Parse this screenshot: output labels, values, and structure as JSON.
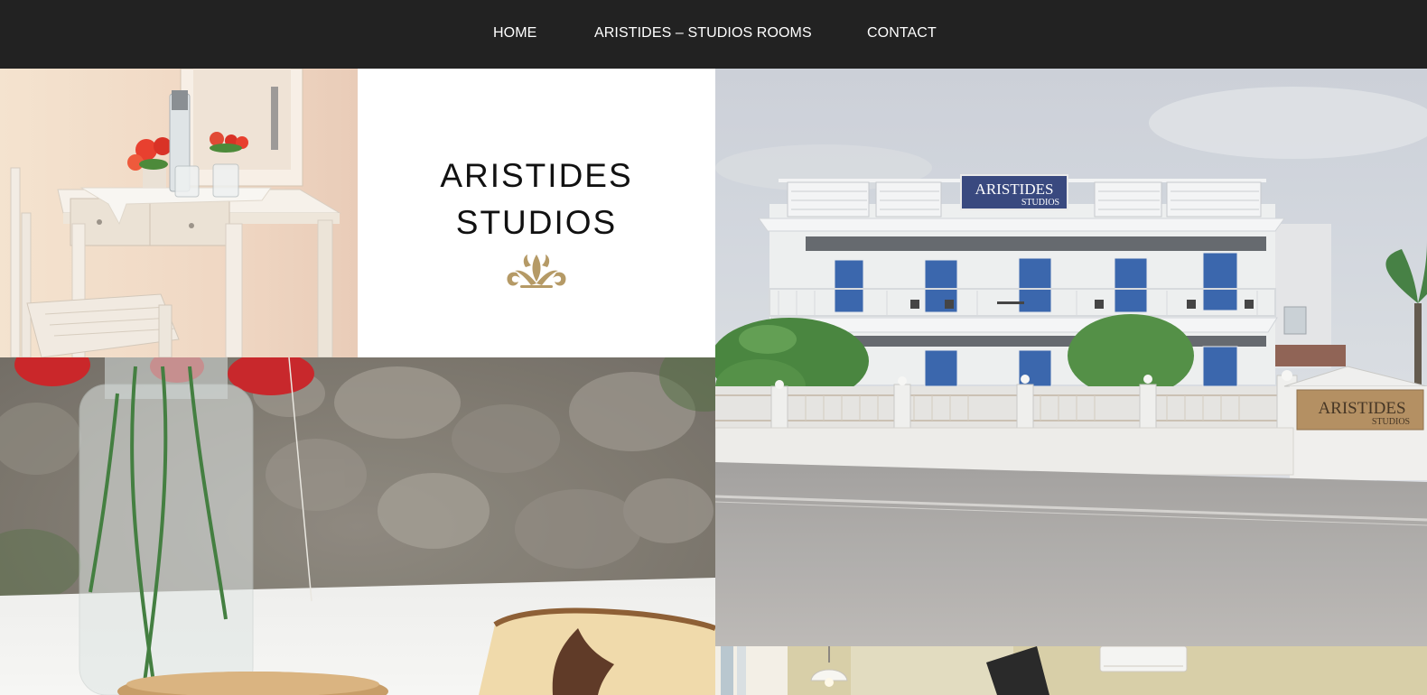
{
  "nav": {
    "items": [
      {
        "label": "HOME"
      },
      {
        "label": "ARISTIDES – STUDIOS ROOMS"
      },
      {
        "label": "CONTACT"
      }
    ]
  },
  "brand": {
    "line1": "ARISTIDES",
    "line2": "STUDIOS",
    "ornament_icon": "fleur-ornament-icon"
  },
  "hotel_photo": {
    "roof_sign": {
      "line1": "ARISTIDES",
      "line2": "STUDIOS"
    },
    "gate_sign": {
      "line1": "ARISTIDES",
      "line2": "STUDIOS"
    }
  },
  "colors": {
    "nav_bg": "#222222",
    "nav_text": "#ffffff",
    "brand_text": "#111111",
    "ornament_gold": "#b59a66",
    "sign_blue": "#2d3e78"
  }
}
